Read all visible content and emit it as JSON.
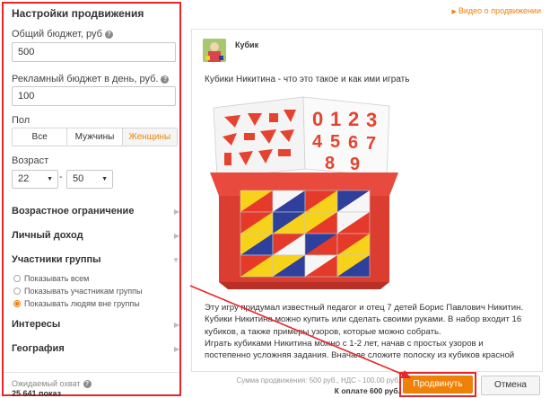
{
  "left_panel": {
    "title": "Настройки продвижения",
    "budget_label": "Общий бюджет, руб",
    "budget_value": "500",
    "daily_label": "Рекламный бюджет в день, руб.",
    "daily_value": "100",
    "gender_label": "Пол",
    "gender_options": [
      "Все",
      "Мужчины",
      "Женщины"
    ],
    "gender_selected": "Женщины",
    "age_label": "Возраст",
    "age_from": "22",
    "age_dash": "-",
    "age_to": "50",
    "sections": {
      "age_restriction": "Возрастное ограничение",
      "income": "Личный доход",
      "group_members": "Участники группы",
      "interests": "Интересы",
      "geography": "География"
    },
    "group_radios": [
      "Показывать всем",
      "Показывать участникам группы",
      "Показывать людям вне группы"
    ],
    "group_radio_selected_index": 2,
    "reach_label": "Ожидаемый охват",
    "reach_value": "25 641 показ",
    "help_glyph": "?"
  },
  "right_area": {
    "video_link": "Видео о продвижении",
    "post": {
      "author": "Кубик",
      "title": "Кубики Никитина - что это такое и как ими играть",
      "body_lines": [
        "Эту игру придумал известный педагог и отец 7 детей Борис Павлович Никитин.",
        "Кубики Никитина можно купить или сделать своими руками. В набор входит 16",
        "кубиков, а также примеры узоров, которые можно собрать.",
        "Играть кубиками Никитина можно с 1-2 лет, начав с простых узоров и",
        "постепенно усложняя задания. Вначале сложите полоску из кубиков красной"
      ],
      "image_digits": [
        "0",
        "1",
        "2",
        "3",
        "4",
        "5",
        "6",
        "7",
        "8",
        "9"
      ]
    },
    "summary_line": "Сумма продвижения: 500 руб., НДС - 100.00 руб.",
    "pay_line": "К оплате 600 руб.",
    "promote_label": "Продвинуть",
    "cancel_label": "Отмена"
  },
  "colors": {
    "accent_orange": "#ee8208",
    "highlight_red": "#e8262a",
    "cube_red": "#e53a2a",
    "cube_yellow": "#f7d21b",
    "cube_blue": "#2e3f9c",
    "cube_white": "#f6f6f6",
    "box_red": "#e84a3d"
  },
  "icons": {
    "help": "help-circle-icon",
    "chevron": "chevron-right-icon",
    "caret": "caret-down-icon",
    "play": "play-icon"
  }
}
